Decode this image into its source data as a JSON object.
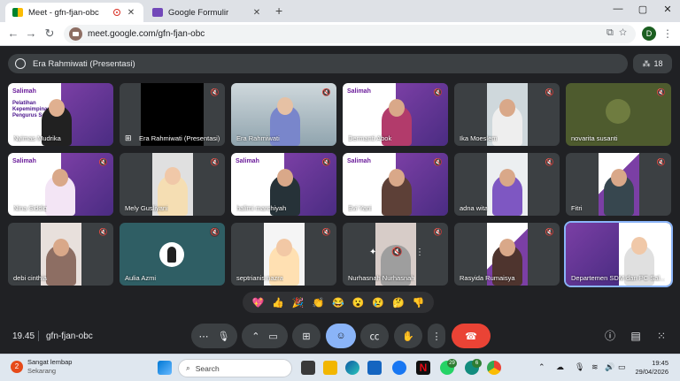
{
  "browser": {
    "tabs": [
      {
        "title": "Meet - gfn-fjan-obc",
        "active": true
      },
      {
        "title": "Google Formulir",
        "active": false
      }
    ],
    "url": "meet.google.com/gfn-fjan-obc",
    "profile_initial": "D"
  },
  "meet": {
    "presenter_label": "Era Rahmiwati (Presentasi)",
    "participant_count": "18",
    "tiles": [
      {
        "name": "Nyimas Mudrika"
      },
      {
        "name": "Era Rahmiwati (Presentasi)"
      },
      {
        "name": "Era Rahmiwati"
      },
      {
        "name": "Dermanti Abok"
      },
      {
        "name": "Ika Moeslem"
      },
      {
        "name": "novarita susanti"
      },
      {
        "name": "Nina Siddiq"
      },
      {
        "name": "Mely Gusliyani"
      },
      {
        "name": "halimi marchiyah"
      },
      {
        "name": "Evi Yani"
      },
      {
        "name": "adna wita"
      },
      {
        "name": "Fitri"
      },
      {
        "name": "debi cinthia"
      },
      {
        "name": "Aulia Azmi"
      },
      {
        "name": "septrianis nazra"
      },
      {
        "name": "Nurhasnah Nurhasnah"
      },
      {
        "name": "Rasyida Rumaisya"
      },
      {
        "name": "Departemen SDM dan PC Sal..."
      }
    ],
    "banner_brand": "Salimah",
    "banner_heading": "Pelatihan Kepemimpinan Pengurus Salimah",
    "reactions": [
      "💖",
      "👍",
      "🎉",
      "👏",
      "😂",
      "😮",
      "😢",
      "🤔",
      "👎"
    ],
    "clock": "19.45",
    "meeting_code": "gfn-fjan-obc"
  },
  "taskbar": {
    "weather_title": "Sangat lembap",
    "weather_sub": "Sekarang",
    "weather_badge": "2",
    "search_placeholder": "Search",
    "time": "19:45",
    "date": "29/04/2026",
    "whatsapp_badge": "29",
    "whatsapp2_badge": "6"
  },
  "colors": {
    "meet_bg": "#202124",
    "end_call": "#ea4335",
    "active_control": "#8ab4f8",
    "banner_purple": "#6a1b9a"
  }
}
